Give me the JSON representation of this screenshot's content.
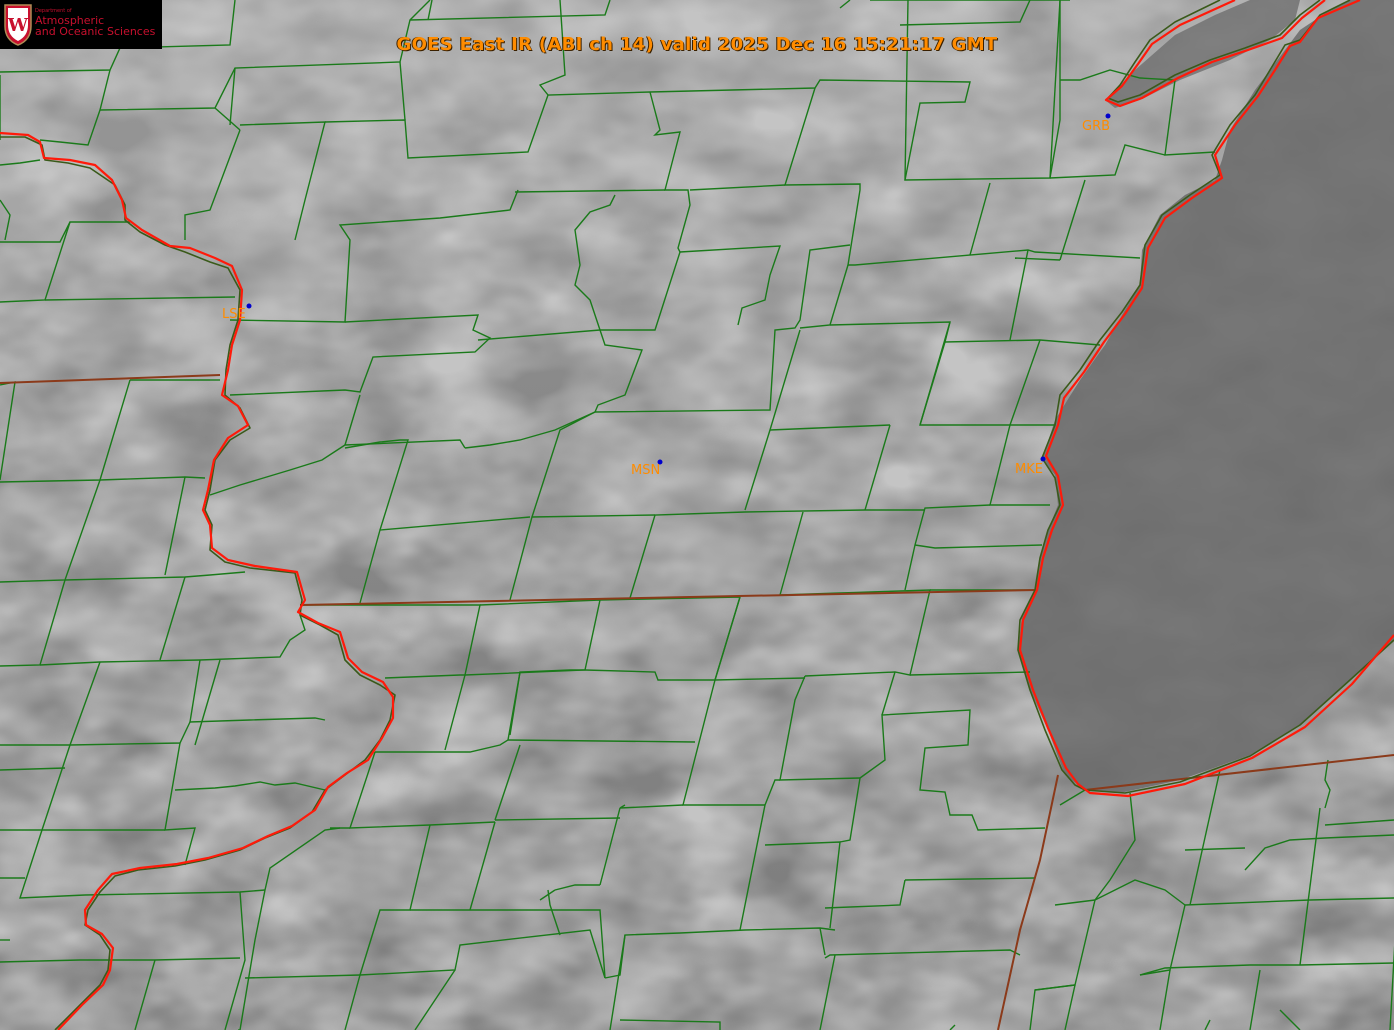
{
  "header": {
    "title": "GOES East IR (ABI ch 14) valid 2025 Dec 16 15:21:17 GMT"
  },
  "logo": {
    "dept_small": "Department of",
    "line1": "Atmospheric",
    "line2": "and Oceanic Sciences",
    "emblem_letter": "W"
  },
  "stations": [
    {
      "id": "GRB"
    },
    {
      "id": "LSE"
    },
    {
      "id": "MSN"
    },
    {
      "id": "MKE"
    }
  ],
  "colors": {
    "county_line": "#1a7a1a",
    "state_line": "#8b3a1a",
    "coast_line": "#ff2a1a",
    "label": "#ff8c00",
    "station_dot": "#0000cc",
    "lake": "#686868"
  }
}
